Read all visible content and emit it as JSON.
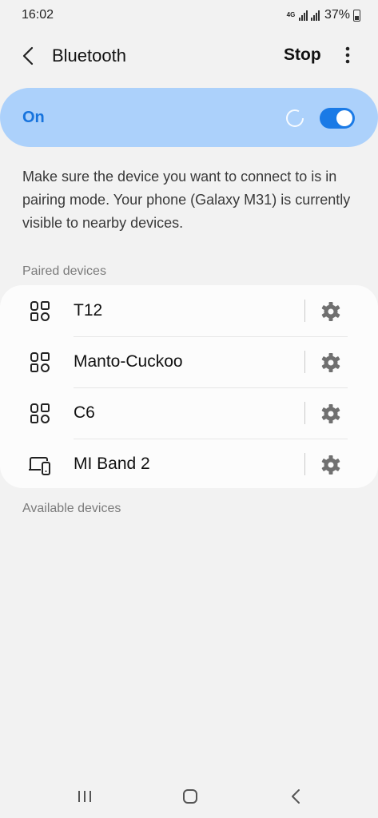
{
  "status": {
    "time": "16:02",
    "network": "4G",
    "battery": "37%"
  },
  "header": {
    "title": "Bluetooth",
    "stop_label": "Stop"
  },
  "toggle": {
    "label": "On",
    "state": "on"
  },
  "info": "Make sure the device you want to connect to is in pairing mode. Your phone (Galaxy M31) is currently visible to nearby devices.",
  "sections": {
    "paired": "Paired devices",
    "available": "Available devices"
  },
  "paired_devices": [
    {
      "name": "T12",
      "icon": "earbuds-icon"
    },
    {
      "name": "Manto-Cuckoo",
      "icon": "earbuds-icon"
    },
    {
      "name": "C6",
      "icon": "earbuds-icon"
    },
    {
      "name": "MI Band 2",
      "icon": "devices-icon"
    }
  ],
  "colors": {
    "accent": "#1a7ae6",
    "toggle_bg": "#acd1fb",
    "label_on": "#1673dd"
  }
}
